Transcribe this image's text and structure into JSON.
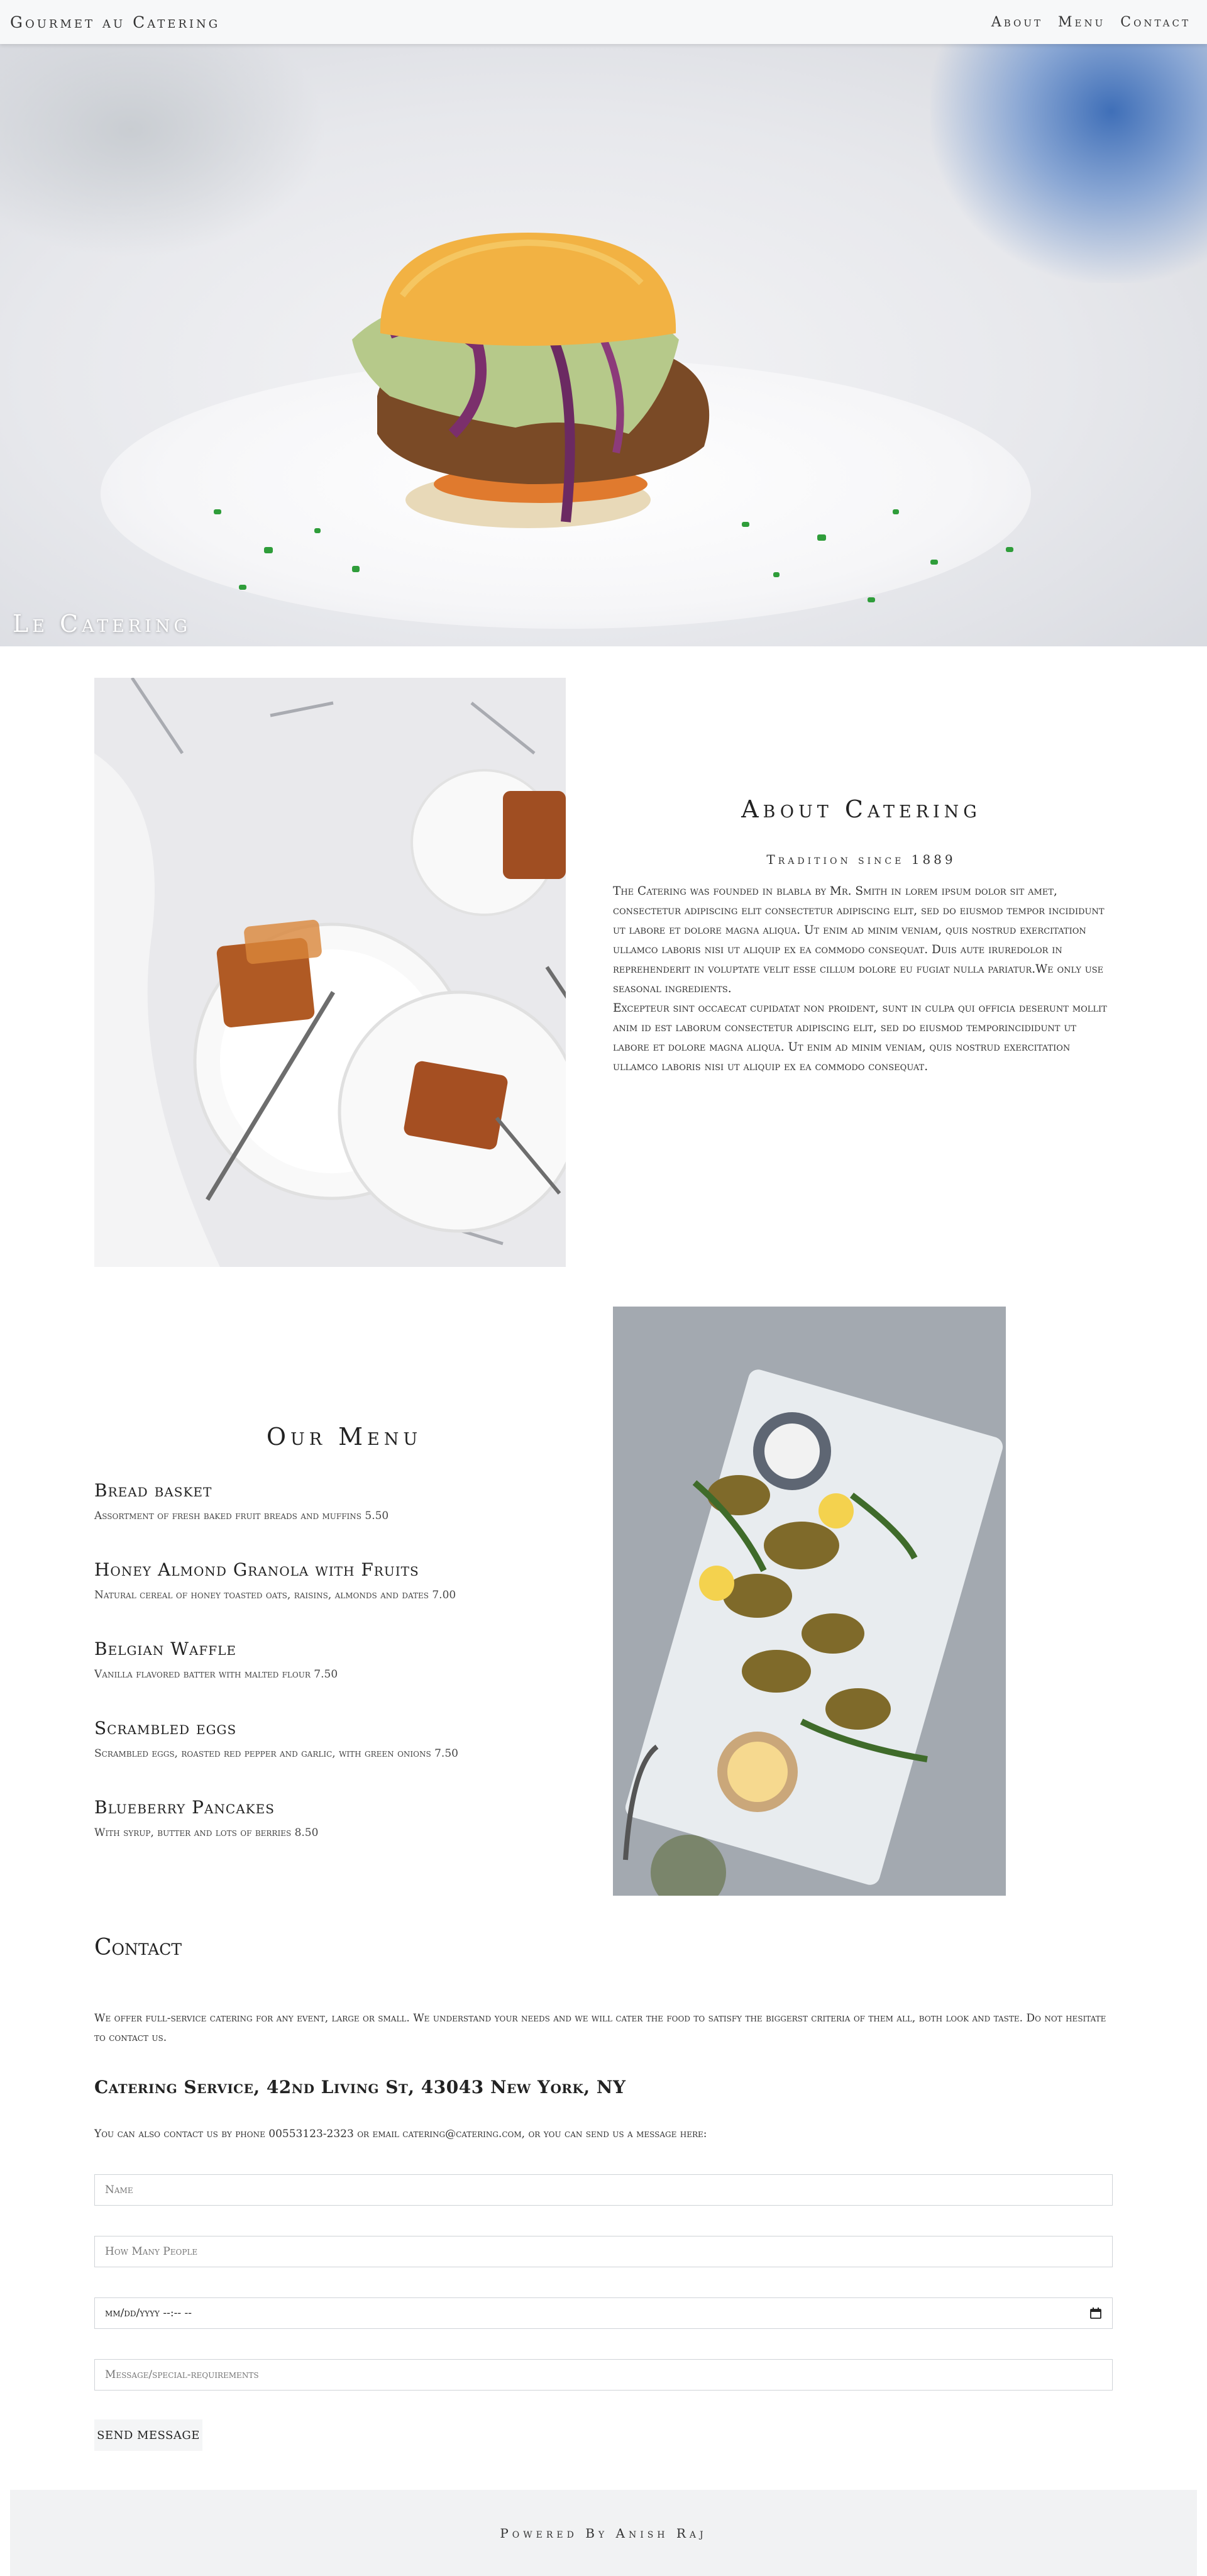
{
  "header": {
    "brand": "Gourmet au Catering",
    "nav": [
      "About",
      "Menu",
      "Contact"
    ]
  },
  "hero": {
    "title": "Le Catering"
  },
  "about": {
    "title": "About Catering",
    "subtitle": "Tradition since 1889",
    "paragraph1": "The Catering was founded in blabla by Mr. Smith in lorem ipsum dolor sit amet, consectetur adipiscing elit consectetur adipiscing elit, sed do eiusmod tempor incididunt ut labore et dolore magna aliqua. Ut enim ad minim veniam, quis nostrud exercitation ullamco laboris nisi ut aliquip ex ea commodo consequat. Duis aute iruredolor in reprehenderit in voluptate velit esse cillum dolore eu fugiat nulla pariatur.We only use seasonal ingredients.",
    "paragraph2": "Excepteur sint occaecat cupidatat non proident, sunt in culpa qui officia deserunt mollit anim id est laborum consectetur adipiscing elit, sed do eiusmod temporincididunt ut labore et dolore magna aliqua. Ut enim ad minim veniam, quis nostrud exercitation ullamco laboris nisi ut aliquip ex ea commodo consequat."
  },
  "menu": {
    "title": "Our Menu",
    "items": [
      {
        "name": "Bread basket",
        "desc": "Assortment of fresh baked fruit breads and muffins 5.50"
      },
      {
        "name": "Honey Almond Granola with Fruits",
        "desc": "Natural cereal of honey toasted oats, raisins, almonds and dates 7.00"
      },
      {
        "name": "Belgian Waffle",
        "desc": "Vanilla flavored batter with malted flour 7.50"
      },
      {
        "name": "Scrambled eggs",
        "desc": "Scrambled eggs, roasted red pepper and garlic, with green onions 7.50"
      },
      {
        "name": "Blueberry Pancakes",
        "desc": "With syrup, butter and lots of berries 8.50"
      }
    ]
  },
  "contact": {
    "title": "Contact",
    "text": "We offer full-service catering for any event, large or small. We understand your needs and we will cater the food to satisfy the biggerst criteria of them all, both look and taste. Do not hesitate to contact us.",
    "address": "Catering Service, 42nd Living St, 43043 New York, NY",
    "note": "You can also contact us by phone 00553123-2323 or email catering@catering.com, or you can send us a message here:",
    "name_placeholder": "Name",
    "people_placeholder": "How Many People",
    "date_value": "mm/dd/yyyy --:-- --",
    "message_placeholder": "Message/special-requirements",
    "send_label": "SEND MESSAGE"
  },
  "footer": {
    "text": "Powered By Anish Raj"
  },
  "icons": {
    "date_picker": "calendar-icon"
  }
}
